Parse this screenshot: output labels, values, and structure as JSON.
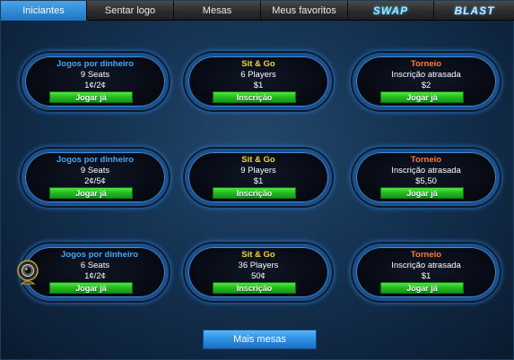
{
  "tabs": [
    {
      "label": "Iniciantes",
      "active": true
    },
    {
      "label": "Sentar logo",
      "active": false
    },
    {
      "label": "Mesas",
      "active": false
    },
    {
      "label": "Meus favoritos",
      "active": false
    },
    {
      "label": "SWAP",
      "active": false
    },
    {
      "label": "BLAST",
      "active": false
    }
  ],
  "tables": [
    {
      "type": "cash",
      "title": "Jogos por dinheiro",
      "line1": "9 Seats",
      "line2": "1¢/2¢",
      "button": "Jogar já"
    },
    {
      "type": "sng",
      "title": "Sit & Go",
      "line1": "6 Players",
      "line2": "$1",
      "button": "Inscrição"
    },
    {
      "type": "tour",
      "title": "Torneio",
      "line1": "Inscrição atrasada",
      "line2": "$2",
      "button": "Jogar já"
    },
    {
      "type": "cash",
      "title": "Jogos por dinheiro",
      "line1": "9 Seats",
      "line2": "2¢/5¢",
      "button": "Jogar já"
    },
    {
      "type": "sng",
      "title": "Sit & Go",
      "line1": "9 Players",
      "line2": "$1",
      "button": "Inscrição"
    },
    {
      "type": "tour",
      "title": "Torneio",
      "line1": "Inscrição atrasada",
      "line2": "$5,50",
      "button": "Jogar já"
    },
    {
      "type": "cash",
      "title": "Jogos por dinheiro",
      "line1": "6 Seats",
      "line2": "1¢/2¢",
      "button": "Jogar já",
      "webcam": true
    },
    {
      "type": "sng",
      "title": "Sit & Go",
      "line1": "36 Players",
      "line2": "50¢",
      "button": "Inscrição"
    },
    {
      "type": "tour",
      "title": "Torneio",
      "line1": "Inscrição atrasada",
      "line2": "$1",
      "button": "Jogar já"
    }
  ],
  "more_button": "Mais mesas",
  "colors": {
    "accent_tab": "#2a8ae0",
    "cash_title": "#3fa9f5",
    "sng_title": "#f3d43a",
    "tour_title": "#ff7a3a",
    "play_button": "#20b520"
  }
}
